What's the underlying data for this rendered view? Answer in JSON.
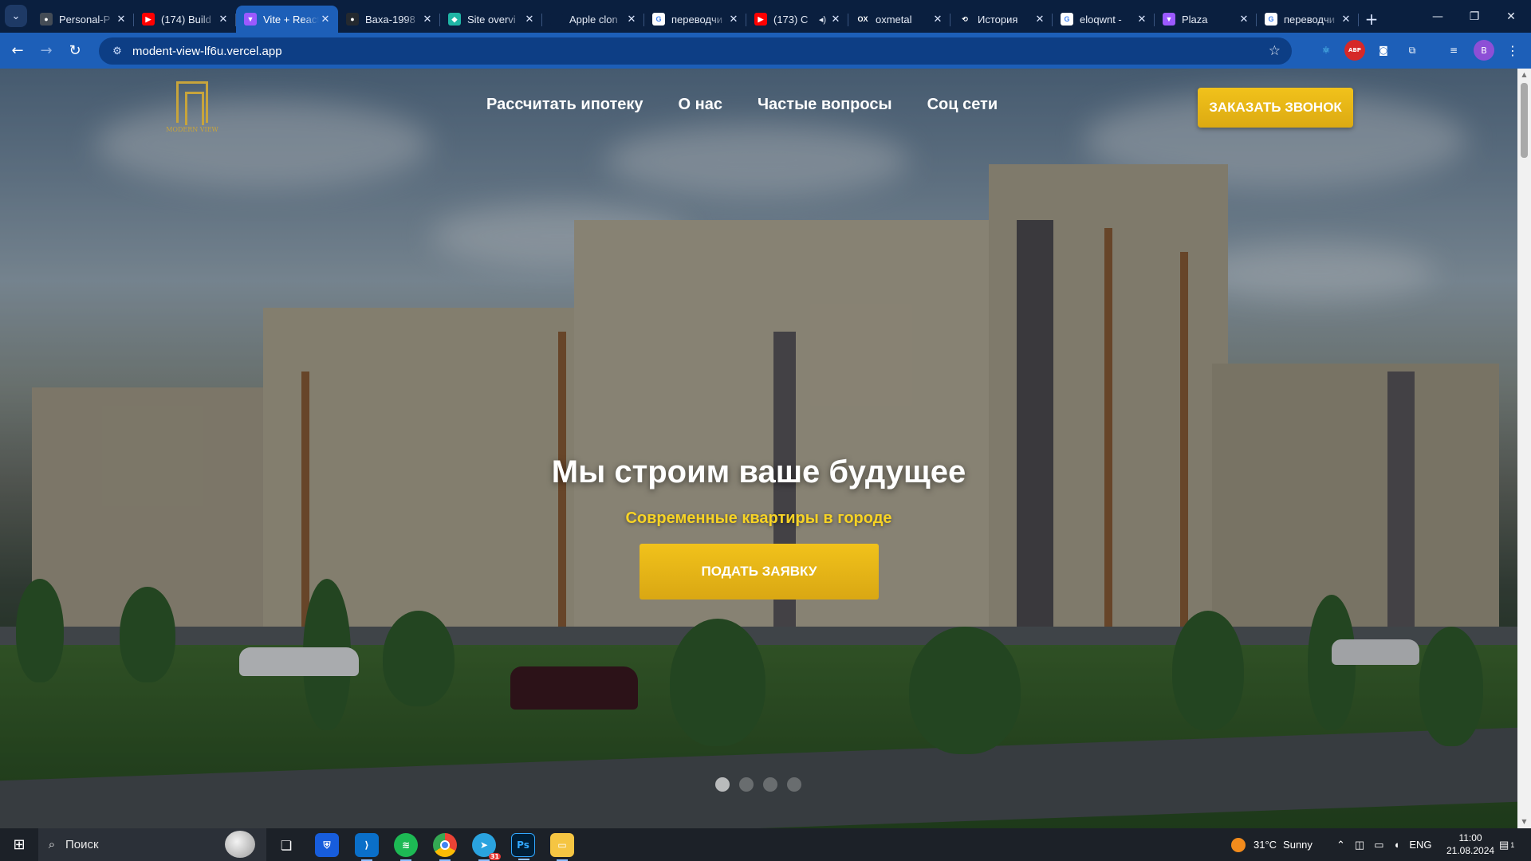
{
  "browser": {
    "tabs": [
      {
        "title": "Personal-P",
        "favicon": "github-icon",
        "color": "#444c56",
        "glyph": "●"
      },
      {
        "title": "(174) Build",
        "favicon": "youtube-icon",
        "color": "#ff0000",
        "glyph": "▶"
      },
      {
        "title": "Vite + React",
        "favicon": "vite-icon",
        "color": "#9b59ff",
        "glyph": "▼",
        "active": true
      },
      {
        "title": "Baxa-1998",
        "favicon": "github-icon",
        "color": "#24292f",
        "glyph": "●"
      },
      {
        "title": "Site overvi",
        "favicon": "netlify-icon",
        "color": "#1fb5a5",
        "glyph": "◆"
      },
      {
        "title": "Apple clon",
        "favicon": "apple-icon",
        "color": "#0a1f3f",
        "glyph": ""
      },
      {
        "title": "переводчи",
        "favicon": "google-icon",
        "color": "#ffffff",
        "glyph": "G"
      },
      {
        "title": "(173) C",
        "favicon": "youtube-icon",
        "color": "#ff0000",
        "glyph": "▶",
        "audio": true
      },
      {
        "title": "oxmetal",
        "favicon": "ox-icon",
        "color": "#0a1f3f",
        "glyph": "OX"
      },
      {
        "title": "История",
        "favicon": "history-icon",
        "color": "#0a1f3f",
        "glyph": "⟲"
      },
      {
        "title": "eloqwnt -",
        "favicon": "google-icon",
        "color": "#ffffff",
        "glyph": "G"
      },
      {
        "title": "Plaza",
        "favicon": "vite-icon",
        "color": "#9b59ff",
        "glyph": "▼"
      },
      {
        "title": "переводчи",
        "favicon": "google-icon",
        "color": "#ffffff",
        "glyph": "G"
      }
    ],
    "new_tab": "+",
    "url": "modent-view-lf6u.vercel.app",
    "profile_initial": "B",
    "extensions": [
      "react-devtools-icon",
      "adblock-icon",
      "camera-icon",
      "extensions-icon",
      "media-icon"
    ],
    "adblock_label": "ABP"
  },
  "site": {
    "logo_text": "MODERN VIEW",
    "nav": [
      "Рассчитать ипотеку",
      "О нас",
      "Частые вопросы",
      "Соц сети"
    ],
    "cta": "ЗАКАЗАТЬ ЗВОНОК",
    "headline": "Мы строим ваше будущее",
    "subheadline": "Современные квартиры в городе",
    "apply_button": "ПОДАТЬ ЗАЯВКУ",
    "slides_total": 4,
    "slide_active": 1,
    "accent": "#f1c21b",
    "sub_color": "#f7d325"
  },
  "taskbar": {
    "search_placeholder": "Поиск",
    "apps": [
      "task-view-icon",
      "bitwarden-icon",
      "vscode-icon",
      "spotify-icon",
      "chrome-icon",
      "telegram-icon",
      "photoshop-icon",
      "file-explorer-icon"
    ],
    "telegram_badge": "31",
    "photoshop_label": "Ps",
    "weather_temp": "31°C",
    "weather_text": "Sunny",
    "language": "ENG",
    "time": "11:00",
    "date": "21.08.2024",
    "notifications": "1"
  }
}
